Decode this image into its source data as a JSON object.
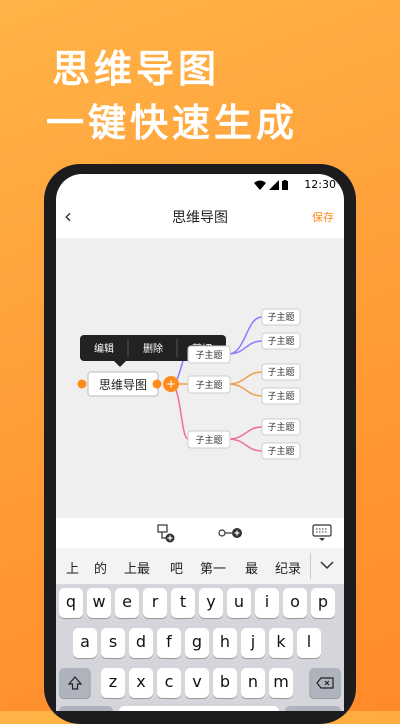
{
  "promo": {
    "line1": "思维导图",
    "line2": "一键快速生成"
  },
  "status": {
    "time": "12:30"
  },
  "nav": {
    "title": "思维导图",
    "save_label": "保存",
    "back_icon": "chevron-left-icon"
  },
  "mindmap": {
    "central": "思维导图",
    "context_menu": [
      "编辑",
      "删除",
      "剪切"
    ],
    "branches": [
      {
        "label": "子主题",
        "children": [
          "子主题",
          "子主题"
        ],
        "color": "#8c7bff"
      },
      {
        "label": "子主题",
        "children": [
          "子主题",
          "子主题"
        ],
        "color": "#f0a04b"
      },
      {
        "label": "子主题",
        "children": [
          "子主题",
          "子主题"
        ],
        "color": "#f07090"
      }
    ],
    "accent": "#ff8c1a"
  },
  "toolbar": {
    "icons": [
      "add-child-node-icon",
      "add-sibling-node-icon",
      "hide-keyboard-icon"
    ]
  },
  "keyboard": {
    "candidates": [
      "上",
      "的",
      "上最",
      "吧",
      "第一",
      "最",
      "纪录"
    ],
    "row1": [
      "q",
      "w",
      "e",
      "r",
      "t",
      "y",
      "u",
      "i",
      "o",
      "p"
    ],
    "row2": [
      "a",
      "s",
      "d",
      "f",
      "g",
      "h",
      "j",
      "k",
      "l"
    ],
    "row3": [
      "z",
      "x",
      "c",
      "v",
      "b",
      "n",
      "m"
    ]
  }
}
